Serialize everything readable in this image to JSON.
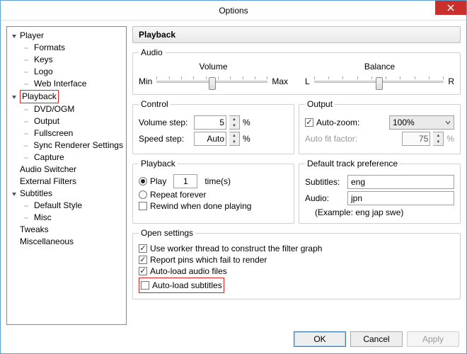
{
  "window": {
    "title": "Options"
  },
  "tree": {
    "player": {
      "label": "Player",
      "children": {
        "formats": "Formats",
        "keys": "Keys",
        "logo": "Logo",
        "web": "Web Interface"
      }
    },
    "playback": {
      "label": "Playback",
      "children": {
        "dvd": "DVD/OGM",
        "output": "Output",
        "fullscreen": "Fullscreen",
        "sync": "Sync Renderer Settings",
        "capture": "Capture"
      }
    },
    "audio_switcher": "Audio Switcher",
    "external_filters": "External Filters",
    "subtitles": {
      "label": "Subtitles",
      "children": {
        "default_style": "Default Style",
        "misc": "Misc"
      }
    },
    "tweaks": "Tweaks",
    "misc": "Miscellaneous"
  },
  "panel": {
    "title": "Playback",
    "audio": {
      "legend": "Audio",
      "volume": {
        "label": "Volume",
        "min": "Min",
        "max": "Max"
      },
      "balance": {
        "label": "Balance",
        "l": "L",
        "r": "R"
      }
    },
    "control": {
      "legend": "Control",
      "volume_step_label": "Volume step:",
      "volume_step_value": "5",
      "speed_step_label": "Speed step:",
      "speed_step_value": "Auto",
      "pct": "%"
    },
    "output": {
      "legend": "Output",
      "auto_zoom_label": "Auto-zoom:",
      "auto_zoom_value": "100%",
      "auto_fit_label": "Auto fit factor:",
      "auto_fit_value": "75",
      "pct": "%"
    },
    "pb": {
      "legend": "Playback",
      "play": "Play",
      "play_count": "1",
      "times": "time(s)",
      "repeat": "Repeat forever",
      "rewind": "Rewind when done playing"
    },
    "track": {
      "legend": "Default track preference",
      "subtitles_label": "Subtitles:",
      "subtitles_value": "eng",
      "audio_label": "Audio:",
      "audio_value": "jpn",
      "example": "(Example: eng jap swe)"
    },
    "open": {
      "legend": "Open settings",
      "c1": "Use worker thread to construct the filter graph",
      "c2": "Report pins which fail to render",
      "c3": "Auto-load audio files",
      "c4": "Auto-load subtitles"
    }
  },
  "footer": {
    "ok": "OK",
    "cancel": "Cancel",
    "apply": "Apply"
  }
}
